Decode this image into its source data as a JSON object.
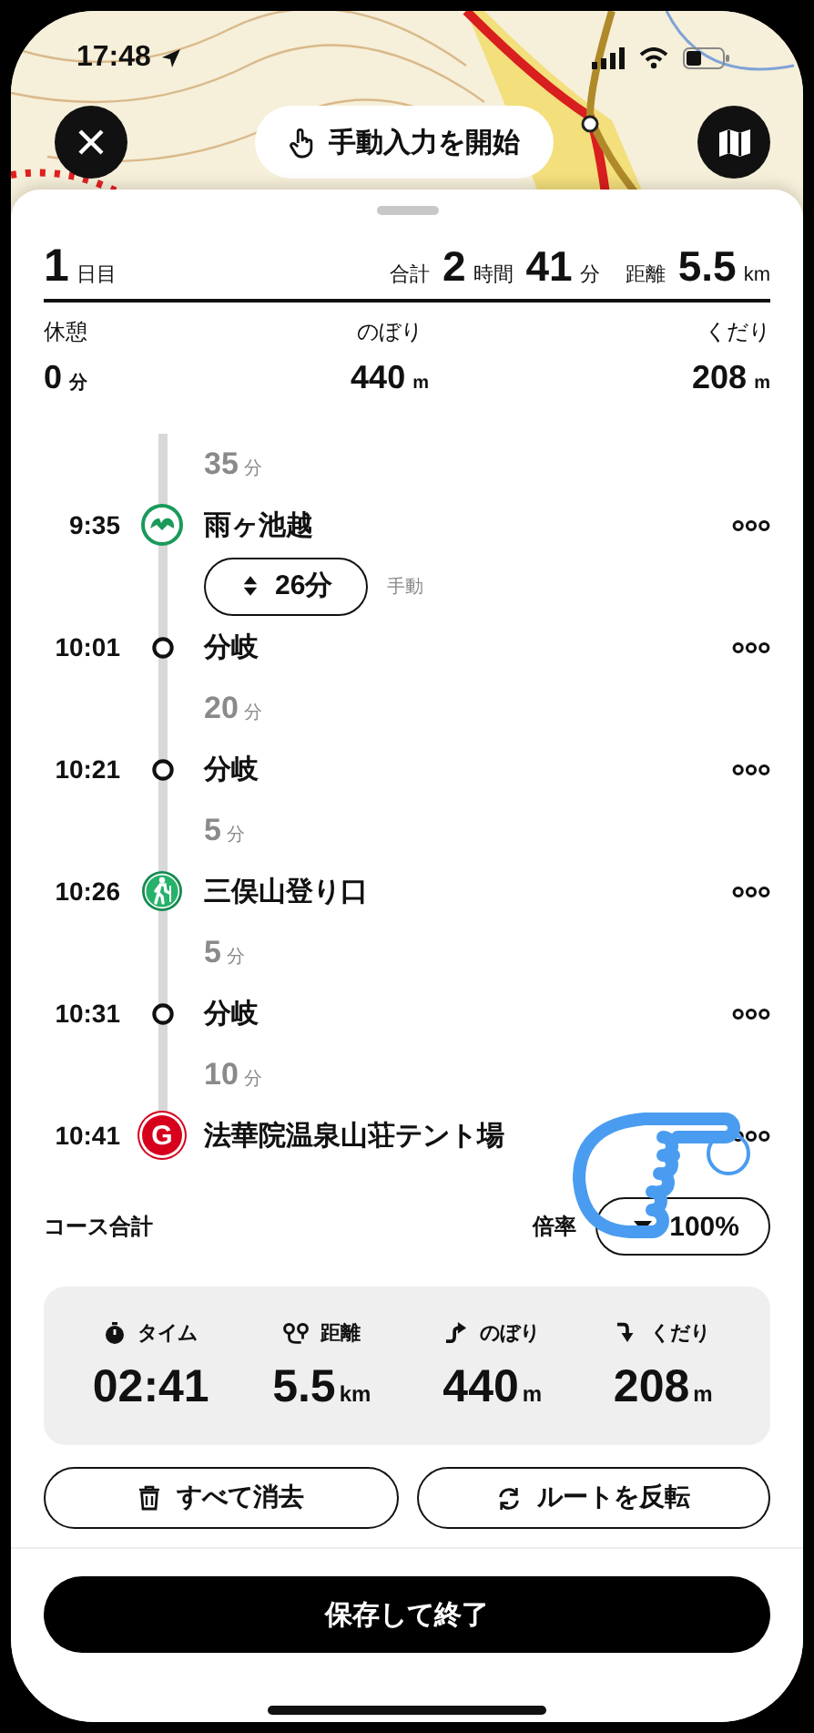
{
  "status_bar": {
    "time": "17:48"
  },
  "start_manual_button": "手動入力を開始",
  "header": {
    "day_number": "1",
    "day_label": "日目",
    "total_label": "合計",
    "hours": "2",
    "hours_unit": "時間",
    "minutes": "41",
    "minutes_unit": "分",
    "distance_label": "距離",
    "distance": "5.5",
    "distance_unit": "km"
  },
  "stats": [
    {
      "label": "休憩",
      "value": "0",
      "unit": "分"
    },
    {
      "label": "のぼり",
      "value": "440",
      "unit": "m"
    },
    {
      "label": "くだり",
      "value": "208",
      "unit": "m"
    }
  ],
  "timeline": [
    {
      "kind": "duration",
      "value": "35",
      "unit": "分"
    },
    {
      "kind": "pass",
      "time": "9:35",
      "name": "雨ヶ池越"
    },
    {
      "kind": "manual",
      "value": "26分",
      "note": "手動"
    },
    {
      "kind": "branch",
      "time": "10:01",
      "name": "分岐"
    },
    {
      "kind": "duration",
      "value": "20",
      "unit": "分"
    },
    {
      "kind": "branch",
      "time": "10:21",
      "name": "分岐"
    },
    {
      "kind": "duration",
      "value": "5",
      "unit": "分"
    },
    {
      "kind": "trailhead",
      "time": "10:26",
      "name": "三俣山登り口"
    },
    {
      "kind": "duration",
      "value": "5",
      "unit": "分"
    },
    {
      "kind": "branch",
      "time": "10:31",
      "name": "分岐"
    },
    {
      "kind": "duration",
      "value": "10",
      "unit": "分"
    },
    {
      "kind": "goal",
      "badge": "G",
      "time": "10:41",
      "name": "法華院温泉山荘テント場"
    }
  ],
  "course_total_label": "コース合計",
  "pace": {
    "label": "倍率",
    "value": "100%"
  },
  "summary": [
    {
      "kind": "time",
      "label": "タイム",
      "value": "02:41"
    },
    {
      "kind": "distance",
      "label": "距離",
      "value": "5.5",
      "unit": "km"
    },
    {
      "kind": "ascent",
      "label": "のぼり",
      "value": "440",
      "unit": "m"
    },
    {
      "kind": "descent",
      "label": "くだり",
      "value": "208",
      "unit": "m"
    }
  ],
  "actions": [
    {
      "kind": "trash",
      "label": "すべて消去"
    },
    {
      "kind": "reverse",
      "label": "ルートを反転"
    }
  ],
  "save_button": "保存して終了"
}
